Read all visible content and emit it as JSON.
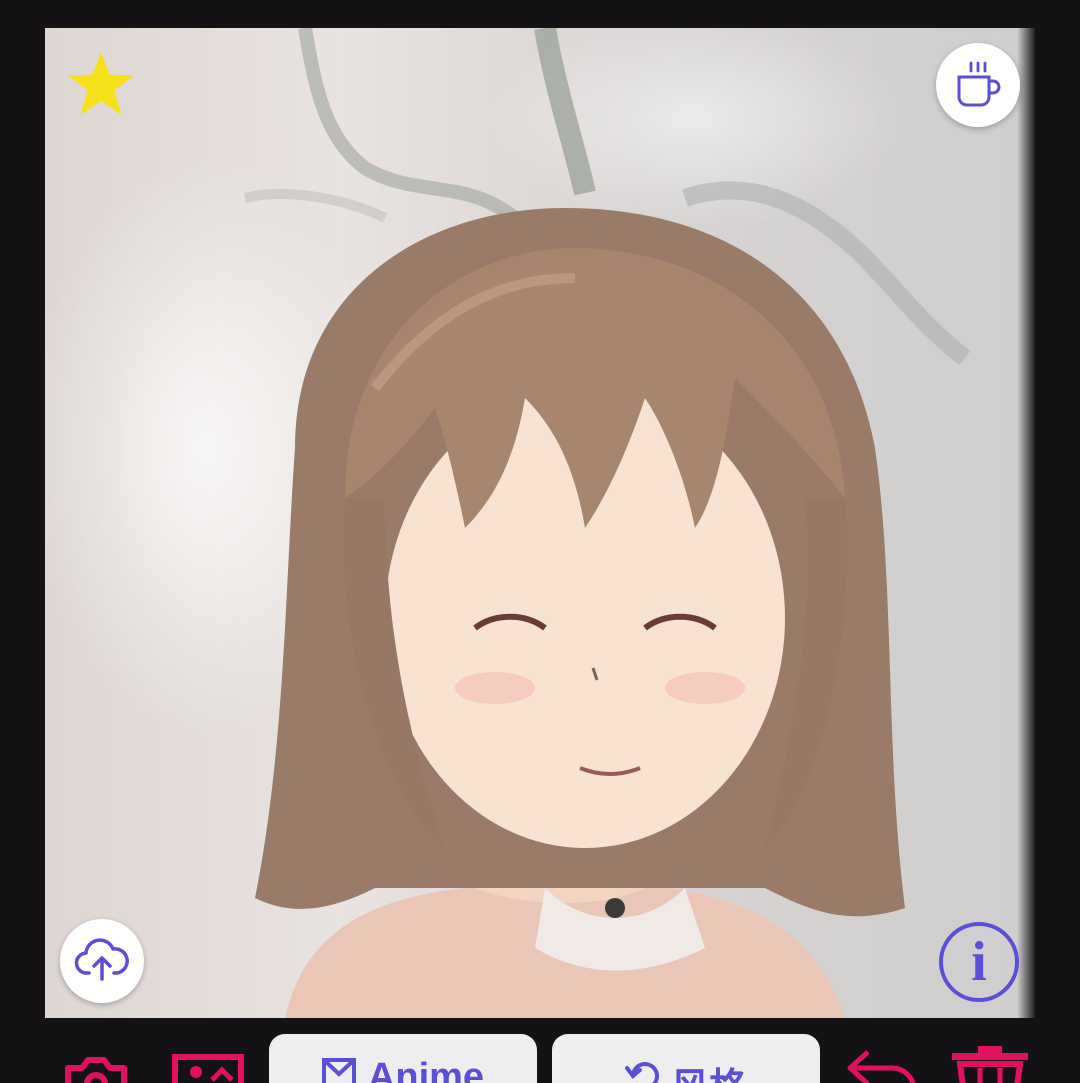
{
  "overlay": {
    "favorite_icon": "star-icon",
    "support_icon": "coffee-icon",
    "upload_icon": "cloud-upload-icon",
    "info_glyph": "i"
  },
  "toolbar": {
    "camera_icon": "camera-icon",
    "gallery_icon": "image-icon",
    "anime_label": "Anime",
    "style_label": "风格",
    "undo_icon": "undo-icon",
    "delete_icon": "trash-icon"
  },
  "colors": {
    "background": "#141214",
    "accent": "#5a4fd6",
    "toolbar_icons": "#e0115f",
    "star": "#f5e11b"
  }
}
